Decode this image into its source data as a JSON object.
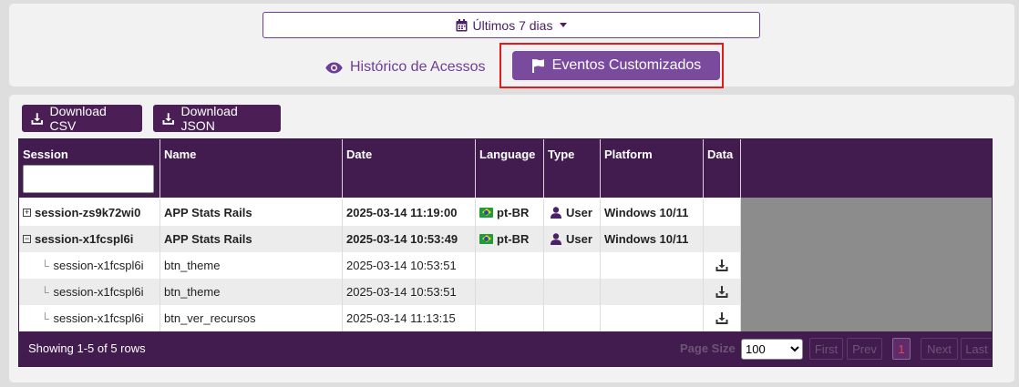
{
  "filters": {
    "date_range_label": "Últimos 7 dias",
    "tabs": [
      {
        "label": "Histórico de Acessos",
        "active": false
      },
      {
        "label": "Eventos Customizados",
        "active": true
      }
    ]
  },
  "toolbar": {
    "download_csv_label": "Download CSV",
    "download_json_label": "Download JSON"
  },
  "table": {
    "columns": [
      "Session",
      "Name",
      "Date",
      "Language",
      "Type",
      "Platform",
      "Data"
    ],
    "session_filter_value": "",
    "rows": [
      {
        "session": "session-zs9k72wi0",
        "name": "APP Stats Rails",
        "date": "2025-03-14 11:19:00",
        "language": "pt-BR",
        "type": "User",
        "platform": "Windows 10/11",
        "data": "",
        "expand": "+"
      },
      {
        "session": "session-x1fcspl6i",
        "name": "APP Stats Rails",
        "date": "2025-03-14 10:53:49",
        "language": "pt-BR",
        "type": "User",
        "platform": "Windows 10/11",
        "data": "",
        "expand": "−"
      },
      {
        "session": "session-x1fcspl6i",
        "name": "btn_theme",
        "date": "2025-03-14 10:53:51",
        "language": "",
        "type": "",
        "platform": "",
        "data": "download-icon"
      },
      {
        "session": "session-x1fcspl6i",
        "name": "btn_theme",
        "date": "2025-03-14 10:53:51",
        "language": "",
        "type": "",
        "platform": "",
        "data": "download-icon"
      },
      {
        "session": "session-x1fcspl6i",
        "name": "btn_ver_recursos",
        "date": "2025-03-14 11:13:15",
        "language": "",
        "type": "",
        "platform": "",
        "data": "download-icon"
      }
    ]
  },
  "footer": {
    "showing_text": "Showing 1-5 of 5 rows",
    "page_size_label": "Page Size",
    "page_size_value": "100",
    "page_size_options": [
      "100"
    ],
    "first_label": "First",
    "prev_label": "Prev",
    "current_page": "1",
    "next_label": "Next",
    "last_label": "Last"
  },
  "colors": {
    "accent": "#7a4a9c",
    "header": "#421c4f",
    "highlight": "#e31b1b"
  }
}
